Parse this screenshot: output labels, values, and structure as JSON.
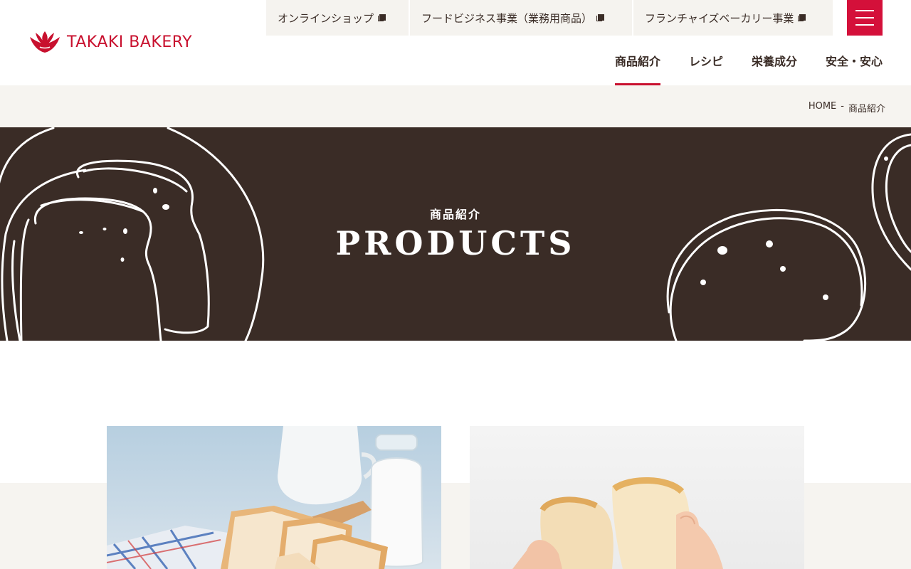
{
  "brand": {
    "name": "TAKAKI BAKERY",
    "color": "#c8102e"
  },
  "external_links": [
    {
      "label": "オンラインショップ",
      "icon": "external-link-icon"
    },
    {
      "label": "フードビジネス事業（業務用商品）",
      "icon": "external-link-icon"
    },
    {
      "label": "フランチャイズベーカリー事業",
      "icon": "external-link-icon"
    }
  ],
  "menu_button": {
    "icon": "hamburger-menu-icon",
    "color": "#d4103a"
  },
  "main_nav": [
    {
      "label": "商品紹介",
      "active": true
    },
    {
      "label": "レシピ",
      "active": false
    },
    {
      "label": "栄養成分",
      "active": false
    },
    {
      "label": "安全・安心",
      "active": false
    }
  ],
  "breadcrumb": {
    "home": "HOME",
    "separator": "-",
    "current": "商品紹介"
  },
  "hero": {
    "subtitle": "商品紹介",
    "title": "PRODUCTS",
    "background": "#3a2c26"
  },
  "cards": [
    {
      "image": "bread-slices-milk-photo"
    },
    {
      "image": "bread-torn-hands-photo"
    }
  ]
}
